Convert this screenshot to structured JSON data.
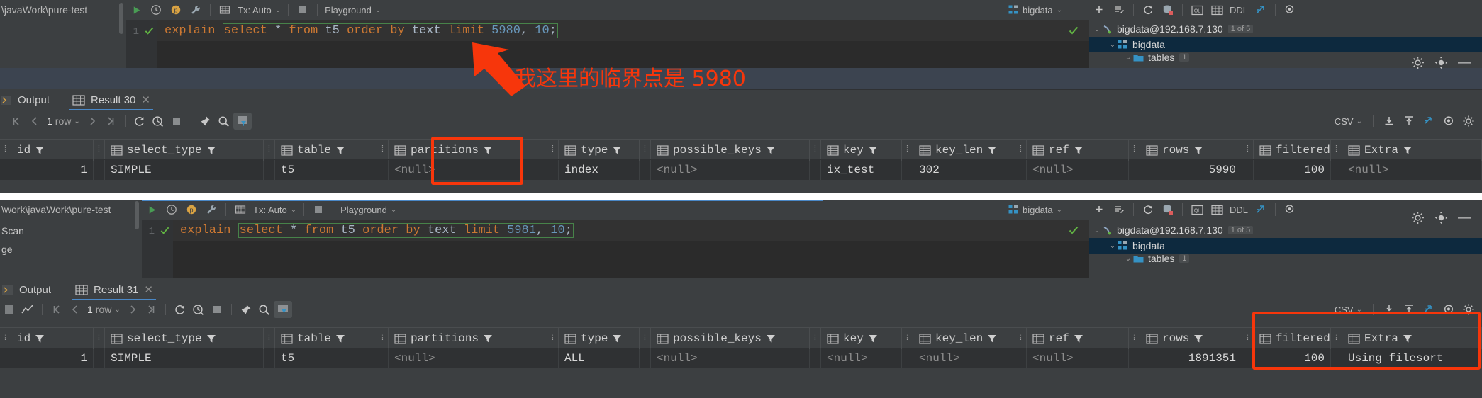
{
  "panels": [
    {
      "project_path": "\\javaWork\\pure-test",
      "editor_toolbar": {
        "run_icon": "run-icon",
        "history_icon": "history-icon",
        "profile_icon": "profile-icon",
        "wrench_icon": "wrench-icon",
        "console_icon": "console-icon",
        "tx_label": "Tx: Auto",
        "stop_icon": "stop-icon",
        "schema_label": "Playground"
      },
      "datasource_label": "bigdata",
      "db_toolbar": {
        "add_icon": "plus-icon",
        "edit_icon": "edit-source-icon",
        "refresh_icon": "refresh-icon",
        "db_icon": "database-red-icon",
        "ql_icon": "ql-icon",
        "grid_icon": "table-grid-icon",
        "ddl_label": "DDL",
        "jump_icon": "jump-to-icon",
        "eye_icon": "eye-icon"
      },
      "tree": [
        {
          "label": "bigdata@192.168.7.130",
          "badge": "1 of 5",
          "icon": "connection-icon",
          "indent": 0,
          "selected": false
        },
        {
          "label": "bigdata",
          "badge": "",
          "icon": "schema-icon",
          "indent": 1,
          "selected": true
        },
        {
          "label": "tables",
          "badge": "1",
          "icon": "folder-icon",
          "indent": 2,
          "selected": false
        }
      ],
      "editor": {
        "line_number": "1",
        "check_icon": "check-icon",
        "tokens": [
          {
            "t": "explain ",
            "c": "kw"
          },
          {
            "t": "select ",
            "c": "kw-box"
          },
          {
            "t": "* ",
            "c": "punc-box"
          },
          {
            "t": "from ",
            "c": "kw-box"
          },
          {
            "t": "t5 ",
            "c": "id-box"
          },
          {
            "t": "order ",
            "c": "kw-box"
          },
          {
            "t": "by ",
            "c": "kw-box"
          },
          {
            "t": "text ",
            "c": "id-box"
          },
          {
            "t": "limit ",
            "c": "kw-box"
          },
          {
            "t": "5980",
            "c": "num-box"
          },
          {
            "t": ", ",
            "c": "punc-box"
          },
          {
            "t": "10",
            "c": "num-box"
          },
          {
            "t": ";",
            "c": "punc"
          }
        ],
        "gutter_ok_icon": "check-icon"
      },
      "tabs": [
        {
          "label": "Output",
          "icon": "output-icon",
          "active": false,
          "closable": false
        },
        {
          "label": "Result 30",
          "icon": "table-grid-icon",
          "active": true,
          "closable": true
        }
      ],
      "grid_toolbar": {
        "first_icon": "first-page-icon",
        "prev_icon": "prev-page-icon",
        "rows_count": "1",
        "rows_label": "row",
        "next_icon": "next-page-icon",
        "last_icon": "last-page-icon",
        "reload_icon": "reload-icon",
        "page_time_icon": "query-time-icon",
        "stop_icon": "stop-icon",
        "pin_icon": "pin-icon",
        "search_icon": "search-icon",
        "filter_icon": "filter-active-icon"
      },
      "csv_group": {
        "format_label": "CSV",
        "import_icon": "import-icon",
        "export_icon": "export-icon",
        "open_icon": "open-in-icon",
        "view_icon": "view-mode-icon",
        "settings_icon": "settings-icon"
      },
      "columns": [
        "id",
        "select_type",
        "table",
        "partitions",
        "type",
        "possible_keys",
        "key",
        "key_len",
        "ref",
        "rows",
        "filtered",
        "Extra"
      ],
      "row": [
        "1",
        "SIMPLE",
        "t5",
        "<null>",
        "index",
        "<null>",
        "ix_test",
        "302",
        "<null>",
        "5990",
        "100",
        "<null>"
      ],
      "highlight_column": "type"
    },
    {
      "project_path": "\\work\\javaWork\\pure-test",
      "left_extra": [
        "Scan",
        "ge"
      ],
      "editor_toolbar": {
        "run_icon": "run-icon",
        "history_icon": "history-icon",
        "profile_icon": "profile-icon",
        "wrench_icon": "wrench-icon",
        "console_icon": "console-icon",
        "tx_label": "Tx: Auto",
        "stop_icon": "stop-icon",
        "schema_label": "Playground"
      },
      "datasource_label": "bigdata",
      "db_toolbar": {
        "add_icon": "plus-icon",
        "edit_icon": "edit-source-icon",
        "refresh_icon": "refresh-icon",
        "db_icon": "database-red-icon",
        "ql_icon": "ql-icon",
        "grid_icon": "table-grid-icon",
        "ddl_label": "DDL",
        "jump_icon": "jump-to-icon",
        "eye_icon": "eye-icon"
      },
      "tree": [
        {
          "label": "bigdata@192.168.7.130",
          "badge": "1 of 5",
          "icon": "connection-icon",
          "indent": 0,
          "selected": false
        },
        {
          "label": "bigdata",
          "badge": "",
          "icon": "schema-icon",
          "indent": 1,
          "selected": true
        },
        {
          "label": "tables",
          "badge": "1",
          "icon": "folder-icon",
          "indent": 2,
          "selected": false
        }
      ],
      "editor": {
        "line_number": "1",
        "check_icon": "check-icon",
        "tokens": [
          {
            "t": "explain ",
            "c": "kw"
          },
          {
            "t": "select ",
            "c": "kw-box"
          },
          {
            "t": "* ",
            "c": "punc-box"
          },
          {
            "t": "from ",
            "c": "kw-box"
          },
          {
            "t": "t5 ",
            "c": "id-box"
          },
          {
            "t": "order ",
            "c": "kw-box"
          },
          {
            "t": "by ",
            "c": "kw-box"
          },
          {
            "t": "text ",
            "c": "id-box"
          },
          {
            "t": "limit ",
            "c": "kw-box"
          },
          {
            "t": "5981",
            "c": "num-box"
          },
          {
            "t": ", ",
            "c": "punc-box"
          },
          {
            "t": "10",
            "c": "num-box"
          },
          {
            "t": ";",
            "c": "punc"
          }
        ]
      },
      "tabs": [
        {
          "label": "Output",
          "icon": "output-icon",
          "active": false,
          "closable": false
        },
        {
          "label": "Result 31",
          "icon": "table-grid-icon",
          "active": true,
          "closable": true
        }
      ],
      "grid_toolbar": {
        "chart_icon": "chart-icon",
        "first_icon": "first-page-icon",
        "prev_icon": "prev-page-icon",
        "rows_count": "1",
        "rows_label": "row",
        "next_icon": "next-page-icon",
        "last_icon": "last-page-icon",
        "reload_icon": "reload-icon",
        "page_time_icon": "query-time-icon",
        "stop_icon": "stop-icon",
        "pin_icon": "pin-icon",
        "search_icon": "search-icon",
        "filter_icon": "filter-active-icon"
      },
      "csv_group": {
        "format_label": "CSV",
        "import_icon": "import-icon",
        "export_icon": "export-icon",
        "open_icon": "open-in-icon",
        "view_icon": "view-mode-icon",
        "settings_icon": "settings-icon"
      },
      "columns": [
        "id",
        "select_type",
        "table",
        "partitions",
        "type",
        "possible_keys",
        "key",
        "key_len",
        "ref",
        "rows",
        "filtered",
        "Extra"
      ],
      "row": [
        "1",
        "SIMPLE",
        "t5",
        "<null>",
        "ALL",
        "<null>",
        "<null>",
        "<null>",
        "<null>",
        "1891351",
        "100",
        "Using filesort"
      ],
      "highlight_column": "Extra"
    }
  ],
  "annotation": {
    "note_text": "我这里的临界点是 5980",
    "color": "#f7360b",
    "arrow": "red-arrow-up-left"
  }
}
